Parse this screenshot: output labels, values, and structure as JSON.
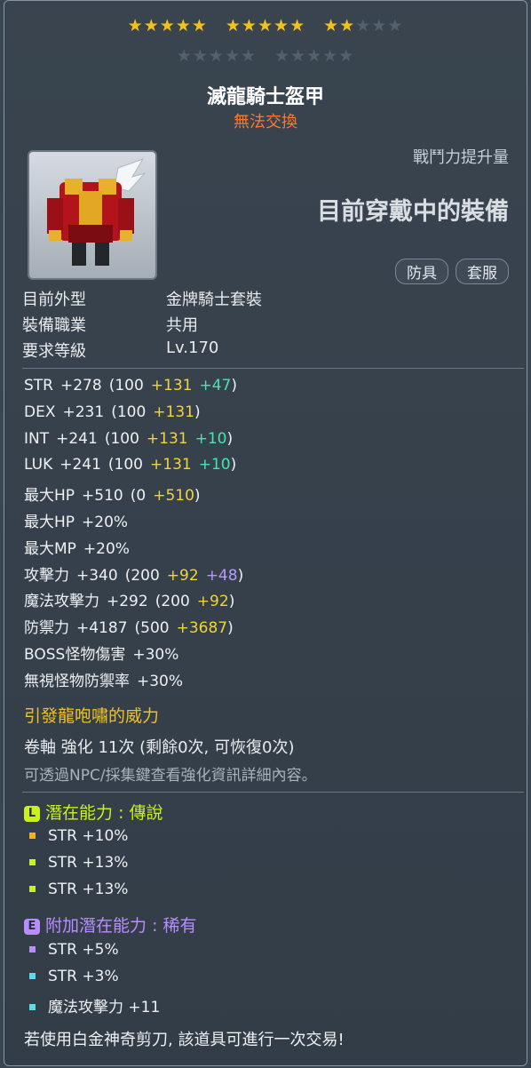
{
  "stars": {
    "filled": 12,
    "total": 25
  },
  "item": {
    "name": "滅龍騎士盔甲",
    "trade": "無法交換",
    "power_label": "戰鬥力提升量",
    "current": "目前穿戴中的裝備",
    "tags": [
      "防具",
      "套服"
    ]
  },
  "info": [
    {
      "label": "目前外型",
      "value": "金牌騎士套裝"
    },
    {
      "label": "裝備職業",
      "value": "共用"
    },
    {
      "label": "要求等級",
      "value": "Lv.170"
    }
  ],
  "stats": [
    {
      "name": "STR",
      "total": "+278",
      "base": "(100",
      "bonus": "+131",
      "star": "+47",
      "close": ")"
    },
    {
      "name": "DEX",
      "total": "+231",
      "base": "(100",
      "bonus": "+131",
      "star": "",
      "close": ")"
    },
    {
      "name": "INT",
      "total": "+241",
      "base": "(100",
      "bonus": "+131",
      "star": "+10",
      "close": ")"
    },
    {
      "name": "LUK",
      "total": "+241",
      "base": "(100",
      "bonus": "+131",
      "star": "+10",
      "close": ")"
    },
    {
      "name": "最大HP",
      "total": "+510",
      "base": "(0",
      "bonus": "+510",
      "star": "",
      "close": ")"
    },
    {
      "name": "最大HP",
      "total": "+20%",
      "base": "",
      "bonus": "",
      "star": "",
      "close": ""
    },
    {
      "name": "最大MP",
      "total": "+20%",
      "base": "",
      "bonus": "",
      "star": "",
      "close": ""
    },
    {
      "name": "攻擊力",
      "total": "+340",
      "base": "(200",
      "bonus": "+92",
      "star": "+48",
      "close": ")"
    },
    {
      "name": "魔法攻擊力",
      "total": "+292",
      "base": "(200",
      "bonus": "+92",
      "star": "",
      "close": ")"
    },
    {
      "name": "防禦力",
      "total": "+4187",
      "base": "(500",
      "bonus": "+3687",
      "star": "",
      "close": ")"
    },
    {
      "name": "BOSS怪物傷害",
      "total": "+30%",
      "base": "",
      "bonus": "",
      "star": "",
      "close": ""
    },
    {
      "name": "無視怪物防禦率",
      "total": "+30%",
      "base": "",
      "bonus": "",
      "star": "",
      "close": ""
    }
  ],
  "set_effect": "引發龍咆嘯的威力",
  "scroll": "卷軸 強化 11次 (剩餘0次, 可恢復0次)",
  "scroll_note": "可透過NPC/採集鍵查看強化資訊詳細內容。",
  "potential": {
    "badge": "L",
    "title": "潛在能力",
    "grade": ": 傳說",
    "color": "#c9f21b",
    "lines": [
      "STR +10%",
      "STR +13%",
      "STR +13%"
    ],
    "dot_colors": [
      "#f2b21a",
      "#c9f21b",
      "#c9f21b"
    ]
  },
  "additional": {
    "badge": "E",
    "title": "附加潛在能力",
    "grade": ": 稀有",
    "color": "#b98cff",
    "lines": [
      "STR +5%",
      "STR +3%",
      "魔法攻擊力 +11"
    ],
    "dot_colors": [
      "#b98cff",
      "#5fd9e8",
      "#5fd9e8"
    ]
  },
  "footer": "若使用白金神奇剪刀, 該道具可進行一次交易!"
}
